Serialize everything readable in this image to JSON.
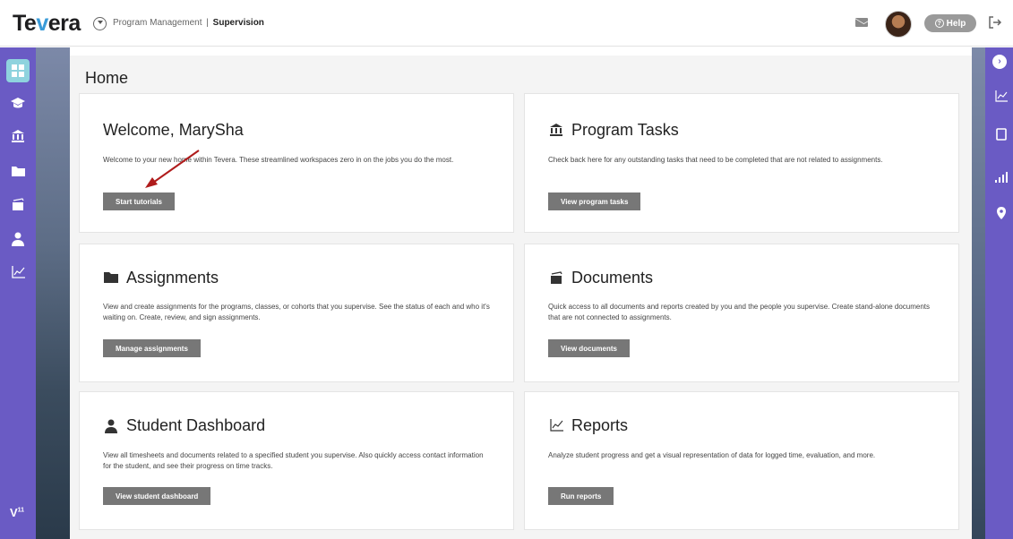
{
  "header": {
    "logo_main": "Te",
    "logo_accent": "v",
    "logo_end": "era",
    "breadcrumb_parent": "Program Management",
    "breadcrumb_sep": "|",
    "breadcrumb_current": "Supervision",
    "help_label": "Help"
  },
  "sidebar": {
    "badge_text": "V",
    "badge_count": "11"
  },
  "main": {
    "page_title": "Home"
  },
  "cards": {
    "welcome": {
      "title": "Welcome, MarySha",
      "description": "Welcome to your new home within Tevera. These streamlined workspaces zero in on the jobs you do the most.",
      "button": "Start tutorials"
    },
    "program_tasks": {
      "title": "Program Tasks",
      "description": "Check back here for any outstanding tasks that need to be completed that are not related to assignments.",
      "button": "View program tasks"
    },
    "assignments": {
      "title": "Assignments",
      "description": "View and create assignments for the programs, classes, or cohorts that you supervise. See the status of each and who it's waiting on. Create, review, and sign assignments.",
      "button": "Manage assignments"
    },
    "documents": {
      "title": "Documents",
      "description": "Quick access to all documents and reports created by you and the people you supervise. Create stand-alone documents that are not connected to assignments.",
      "button": "View documents"
    },
    "student_dashboard": {
      "title": "Student Dashboard",
      "description": "View all timesheets and documents related to a specified student you supervise. Also quickly access contact information for the student, and see their progress on time tracks.",
      "button": "View student dashboard"
    },
    "reports": {
      "title": "Reports",
      "description": "Analyze student progress and get a visual representation of data for logged time, evaluation, and more.",
      "button": "Run reports"
    }
  },
  "colors": {
    "sidebar": "#6a5bc4",
    "active_item": "#8fd3de",
    "button": "#777777",
    "arrow": "#b01c1c",
    "logo_accent": "#3a9bd8"
  },
  "icons": {
    "sidebar": [
      "dashboard-icon",
      "graduation-cap-icon",
      "institution-icon",
      "folder-icon",
      "documents-icon",
      "student-icon",
      "chart-icon"
    ],
    "right_sidebar": [
      "chevron-right-icon",
      "chart-icon",
      "copy-icon",
      "signal-icon",
      "map-marker-icon"
    ]
  }
}
